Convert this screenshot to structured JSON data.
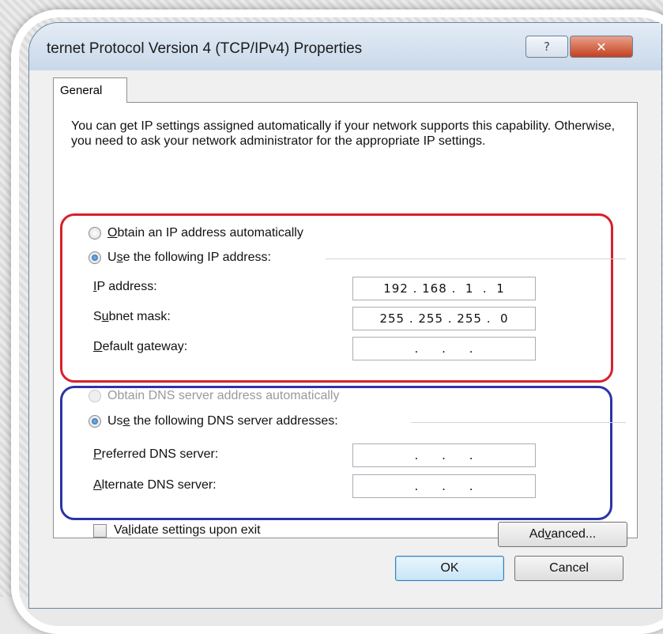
{
  "window": {
    "title": "ternet Protocol Version 4 (TCP/IPv4) Properties",
    "help_symbol": "?",
    "close_symbol": "✕"
  },
  "tabs": [
    {
      "label": "General"
    }
  ],
  "description": "You can get IP settings assigned automatically if your network supports this capability. Otherwise, you need to ask your network administrator for the appropriate IP settings.",
  "ip_section": {
    "auto_option": {
      "u": "O",
      "rest": "btain an IP address automatically",
      "checked": false
    },
    "manual_option": {
      "pre": "U",
      "u": "s",
      "rest": "e the following IP address:",
      "checked": true
    },
    "fields": [
      {
        "u": "I",
        "rest": "P address:",
        "value": "192 . 168 .  1  .  1"
      },
      {
        "pre": "S",
        "u": "u",
        "rest": "bnet mask:",
        "value": "255 . 255 . 255 .  0"
      },
      {
        "u": "D",
        "rest": "efault gateway:",
        "value": " .     .     . "
      }
    ]
  },
  "dns_section": {
    "auto_option": {
      "label": "Obtain DNS server address automatically",
      "checked": false,
      "enabled": false
    },
    "manual_option": {
      "pre": "Us",
      "u": "e",
      "rest": " the following DNS server addresses:",
      "checked": true
    },
    "fields": [
      {
        "u": "P",
        "rest": "referred DNS server:",
        "value": " .     .     . "
      },
      {
        "u": "A",
        "rest": "lternate DNS server:",
        "value": " .     .     . "
      }
    ]
  },
  "validate": {
    "pre": "Va",
    "u": "l",
    "rest": "idate settings upon exit",
    "checked": false
  },
  "buttons": {
    "advanced": {
      "pre": "Ad",
      "u": "v",
      "rest": "anced..."
    },
    "ok": "OK",
    "cancel": "Cancel"
  },
  "colors": {
    "ip_highlight": "#d8202a",
    "dns_highlight": "#2b34a7"
  }
}
